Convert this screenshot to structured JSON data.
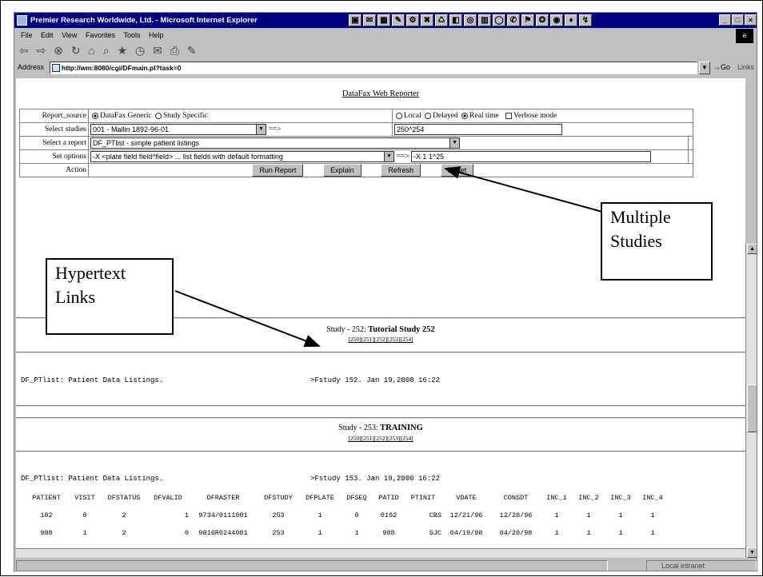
{
  "window": {
    "title": "Premier Research Worldwide, Ltd. - Microsoft Internet Explorer",
    "menu": [
      "File",
      "Edit",
      "View",
      "Favorites",
      "Tools",
      "Help"
    ],
    "address_label": "Address",
    "address_url": "http://wm:8080/cgi/DFmain.pl?task=0",
    "go_label": "Go",
    "links_label": "Links",
    "status_zone": "Local intranet"
  },
  "page": {
    "heading": "DataFax Web Reporter",
    "form": {
      "report_source_label": "Report_source",
      "report_source_opt1": "DataFax Generic",
      "report_source_opt2": "Study Specific",
      "mode_opt1": "Local",
      "mode_opt2": "Delayed",
      "mode_opt3": "Real time",
      "verbose_label": "Verbose mode",
      "select_studies_label": "Select studies",
      "select_studies_value": "001 - Mallin 1892-96-01",
      "arrow1": "==>",
      "studies_text_value": "250^254",
      "select_report_label": "Select a report",
      "select_report_value": "DF_PTlist    - simple patient listings",
      "set_options_label": "Set options",
      "set_options_value": "-X <plate field field^field> ... list fields with default formatting",
      "arrow2": "==>",
      "options_text_value": "-X 1 1^25",
      "action_label": "Action",
      "run_label": "Run Report",
      "explain_label": "Explain",
      "refresh_label": "Refresh",
      "reset_label": "Reset"
    },
    "study1": {
      "prefix": "Study - 252:",
      "name": "Tutorial Study 252",
      "links": [
        "[250]",
        "[251]",
        "[252]",
        "[253]",
        "[254]"
      ],
      "list_left": "DF_PTlist: Patient Data Listings.",
      "list_right": ">Fstudy 152. Jan 19,2000 16:22"
    },
    "study2": {
      "prefix": "Study - 253:",
      "name": "TRAINING",
      "links": [
        "[250]",
        "[251]",
        "[252]",
        "[253]",
        "[254]"
      ],
      "list_left": "DF_PTlist: Patient Data Listings.",
      "list_right": ">Fstudy 153. Jan 19,2000 16:22"
    },
    "table": {
      "headers": [
        "PATIENT",
        "VISIT",
        "DFSTATUS",
        "DFVALID",
        "DFRASTER",
        "DFSTUDY",
        "DFPLATE",
        "DFSEQ",
        "PATID",
        "PTINIT",
        "VDATE",
        "CONSDT",
        "INC_1",
        "INC_2",
        "INC_3",
        "INC_4"
      ],
      "rows": [
        [
          "102",
          "0",
          "2",
          "1",
          "9734/0111001",
          "253",
          "1",
          "0",
          "0102",
          "CBS",
          "12/21/96",
          "12/20/96",
          "1",
          "1",
          "1",
          "1"
        ],
        [
          "988",
          "1",
          "2",
          "0",
          "9816R0244001",
          "253",
          "1",
          "1",
          "988",
          "SJC",
          "04/19/98",
          "04/20/98",
          "1",
          "1",
          "1",
          "1"
        ]
      ]
    }
  },
  "annotations": {
    "multiple_studies": "Multiple Studies",
    "hypertext_links": "Hypertext Links"
  }
}
